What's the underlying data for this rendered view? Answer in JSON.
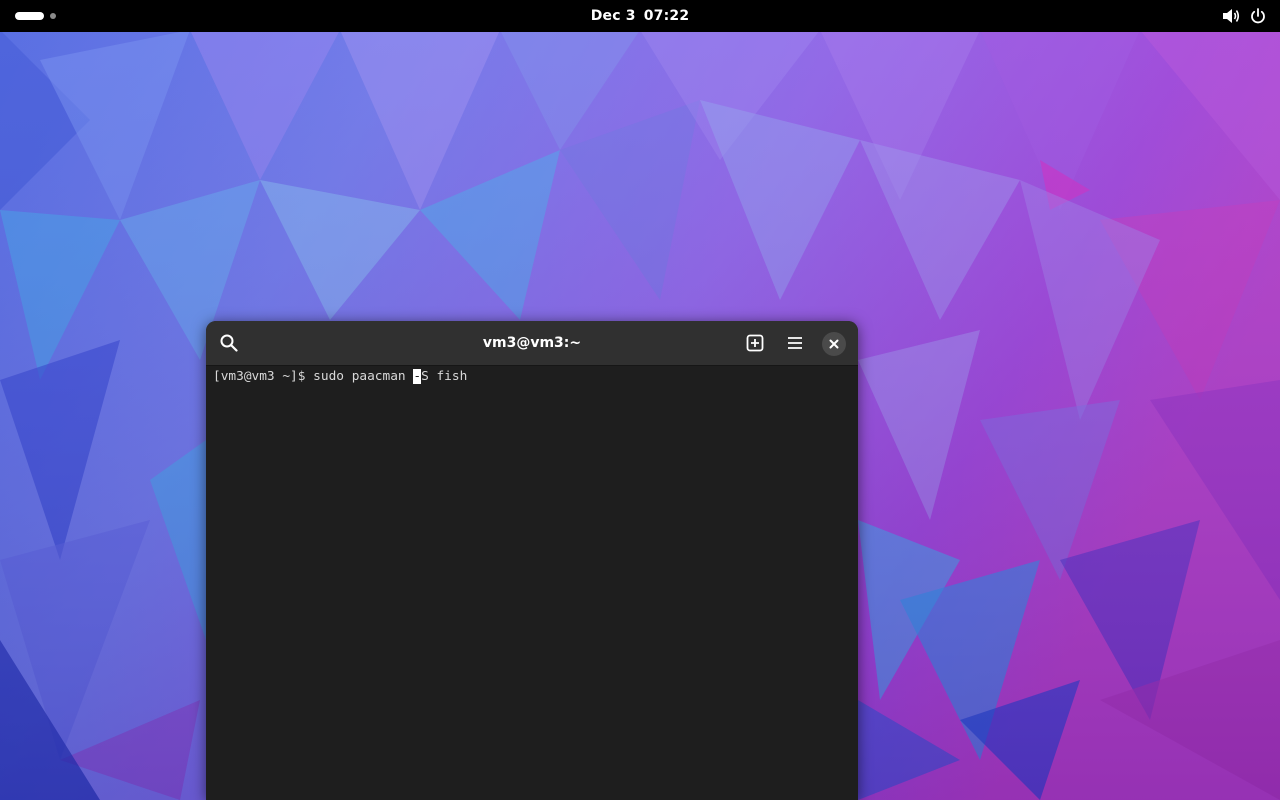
{
  "topbar": {
    "date": "Dec 3",
    "time": "07:22",
    "icons": [
      "activities-workspace-indicator",
      "volume-icon",
      "power-icon"
    ]
  },
  "terminal": {
    "title": "vm3@vm3:~",
    "icons": [
      "search-icon",
      "new-tab-icon",
      "hamburger-menu-icon",
      "close-icon"
    ],
    "prompt": "[vm3@vm3 ~]$ ",
    "command_before_cursor": "sudo paacman ",
    "cursor_char": "-",
    "command_after_cursor": "S fish"
  },
  "colors": {
    "topbar_bg": "#000000",
    "headerbar_bg": "#303030",
    "terminal_bg": "#1e1e1e",
    "terminal_fg": "#d8d8d8",
    "close_button_bg": "#4a4a4a"
  }
}
